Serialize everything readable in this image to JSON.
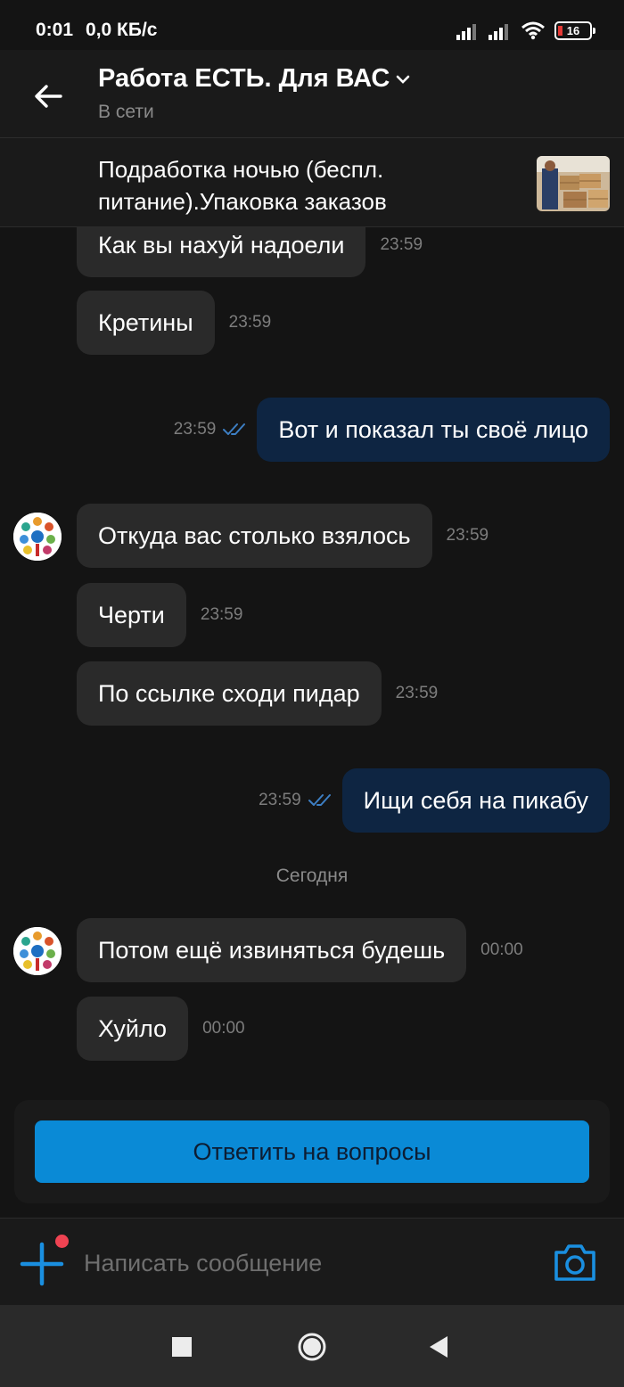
{
  "status_bar": {
    "time": "0:01",
    "speed": "0,0 КБ/с",
    "battery": "16"
  },
  "header": {
    "title": "Работа ЕСТЬ. Для ВАС",
    "status": "В сети"
  },
  "pinned": {
    "text": "Подработка ночью (беспл. питание).Упаковка заказов"
  },
  "messages": [
    {
      "dir": "in",
      "text": "Как вы нахуй надоели",
      "time": "23:59"
    },
    {
      "dir": "in",
      "text": "Кретины",
      "time": "23:59"
    },
    {
      "dir": "out",
      "text": "Вот и показал ты своё лицо",
      "time": "23:59"
    },
    {
      "dir": "in",
      "text": "Откуда вас столько взялось",
      "time": "23:59"
    },
    {
      "dir": "in",
      "text": "Черти",
      "time": "23:59"
    },
    {
      "dir": "in",
      "text": "По ссылке сходи пидар",
      "time": "23:59"
    },
    {
      "dir": "out",
      "text": "Ищи себя на пикабу",
      "time": "23:59"
    },
    {
      "dir": "in",
      "text": "Потом ещё извиняться будешь",
      "time": "00:00"
    },
    {
      "dir": "in",
      "text": "Хуйло",
      "time": "00:00"
    }
  ],
  "date_separator": "Сегодня",
  "cta": {
    "label": "Ответить на вопросы"
  },
  "composer": {
    "placeholder": "Написать сообщение"
  },
  "colors": {
    "background": "#141414",
    "incoming_bubble": "#2a2a2a",
    "outgoing_bubble": "#0e2542",
    "accent": "#0a8ad6",
    "read_check": "#3d7fc4",
    "notification_dot": "#ef4352"
  },
  "icons": [
    "back-arrow-icon",
    "chevron-down-icon",
    "double-check-icon",
    "plus-icon",
    "camera-icon",
    "wifi-icon",
    "signal-icon",
    "battery-icon",
    "nav-square-icon",
    "nav-circle-icon",
    "nav-back-icon"
  ]
}
